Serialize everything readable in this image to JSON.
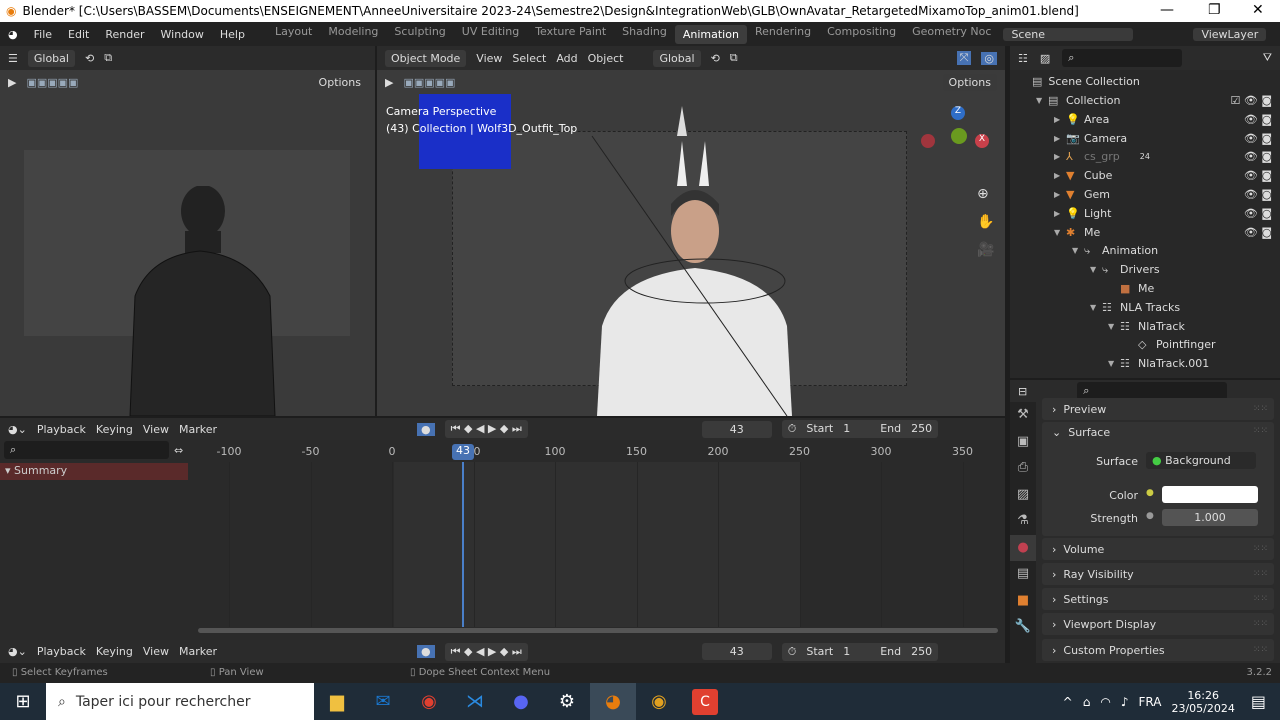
{
  "title_bar": {
    "title": "Blender* [C:\\Users\\BASSEM\\Documents\\ENSEIGNEMENT\\AnneeUniversitaire 2023-24\\Semestre2\\Design&IntegrationWeb\\GLB\\OwnAvatar_RetargetedMixamoTop_anim01.blend]"
  },
  "menu": [
    "File",
    "Edit",
    "Render",
    "Window",
    "Help"
  ],
  "workspaces": [
    "Layout",
    "Modeling",
    "Sculpting",
    "UV Editing",
    "Texture Paint",
    "Shading",
    "Animation",
    "Rendering",
    "Compositing",
    "Geometry Noc"
  ],
  "active_workspace": "Animation",
  "scene": "Scene",
  "view_layer": "ViewLayer",
  "left_view": {
    "orientation": "Global",
    "options": "Options"
  },
  "main_view": {
    "mode": "Object Mode",
    "menus": [
      "View",
      "Select",
      "Add",
      "Object"
    ],
    "orientation": "Global",
    "options": "Options",
    "overlay_title": "Camera Perspective",
    "overlay_sub": "(43) Collection | Wolf3D_Outfit_Top"
  },
  "outliner": {
    "root": "Scene Collection",
    "items": [
      {
        "label": "Collection",
        "indent": 0,
        "icon": "collection"
      },
      {
        "label": "Area",
        "indent": 1,
        "icon": "light"
      },
      {
        "label": "Camera",
        "indent": 1,
        "icon": "camera"
      },
      {
        "label": "cs_grp",
        "indent": 1,
        "icon": "empty",
        "badge": "24"
      },
      {
        "label": "Cube",
        "indent": 1,
        "icon": "mesh"
      },
      {
        "label": "Gem",
        "indent": 1,
        "icon": "mesh"
      },
      {
        "label": "Light",
        "indent": 1,
        "icon": "light"
      },
      {
        "label": "Me",
        "indent": 1,
        "icon": "armature"
      },
      {
        "label": "Animation",
        "indent": 2,
        "icon": "anim"
      },
      {
        "label": "Drivers",
        "indent": 3,
        "icon": "drivers"
      },
      {
        "label": "Me",
        "indent": 4,
        "icon": "object"
      },
      {
        "label": "NLA Tracks",
        "indent": 3,
        "icon": "nla"
      },
      {
        "label": "NlaTrack",
        "indent": 4,
        "icon": "nla"
      },
      {
        "label": "Pointfinger",
        "indent": 5,
        "icon": "action"
      },
      {
        "label": "NlaTrack.001",
        "indent": 4,
        "icon": "nla"
      }
    ]
  },
  "properties": {
    "panels": {
      "preview": "Preview",
      "surface": "Surface",
      "volume": "Volume",
      "ray": "Ray Visibility",
      "settings": "Settings",
      "viewport": "Viewport Display",
      "custom": "Custom Properties"
    },
    "surface_label": "Surface",
    "surface_value": "Background",
    "color_label": "Color",
    "color_value": "#ffffff",
    "strength_label": "Strength",
    "strength_value": "1.000"
  },
  "timeline": {
    "menus": [
      "Playback",
      "Keying",
      "View",
      "Marker"
    ],
    "current_frame": "43",
    "start_label": "Start",
    "start": "1",
    "end_label": "End",
    "end": "250",
    "ticks": [
      "-100",
      "-50",
      "0",
      "50",
      "100",
      "150",
      "200",
      "250",
      "300",
      "350"
    ],
    "summary": "Summary"
  },
  "status": {
    "select": "Select Keyframes",
    "pan": "Pan View",
    "context": "Dope Sheet Context Menu",
    "version": "3.2.2"
  },
  "taskbar": {
    "search": "Taper ici pour rechercher",
    "lang": "FRA",
    "time": "16:26",
    "date": "23/05/2024"
  }
}
